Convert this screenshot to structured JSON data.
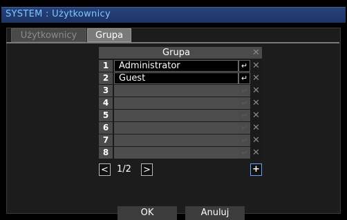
{
  "window": {
    "title": "SYSTEM : Użytkownicy"
  },
  "tabs": [
    {
      "label": "Użytkownicy",
      "active": false
    },
    {
      "label": "Grupa",
      "active": true
    }
  ],
  "table": {
    "header": "Grupa",
    "delete_symbol": "✕",
    "enter_symbol": "↵",
    "rows": [
      {
        "num": "1",
        "name": "Administrator"
      },
      {
        "num": "2",
        "name": "Guest"
      },
      {
        "num": "3",
        "name": ""
      },
      {
        "num": "4",
        "name": ""
      },
      {
        "num": "5",
        "name": ""
      },
      {
        "num": "6",
        "name": ""
      },
      {
        "num": "7",
        "name": ""
      },
      {
        "num": "8",
        "name": ""
      }
    ]
  },
  "pager": {
    "prev": "<",
    "page_info": "1/2",
    "next": ">",
    "add": "+"
  },
  "buttons": {
    "ok": "OK",
    "cancel": "Anuluj"
  },
  "colors": {
    "title_bar": "#1d3466",
    "title_text": "#7fc8ff",
    "add_button_border": "#6aa0ff"
  }
}
